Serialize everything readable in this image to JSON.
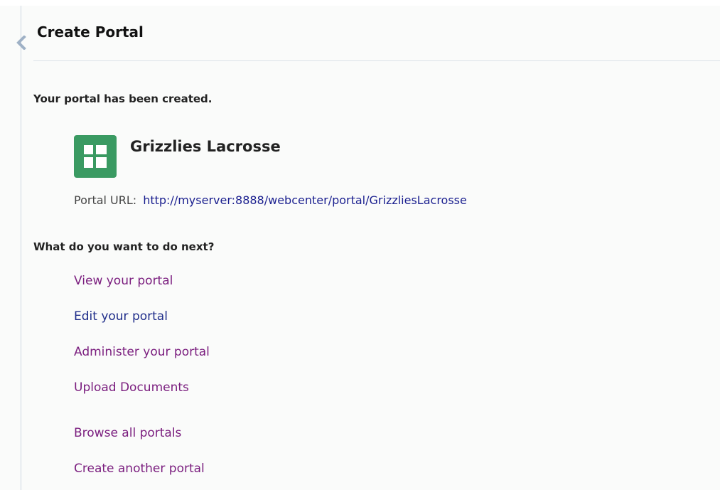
{
  "header": {
    "title": "Create Portal",
    "back_icon": "chevron-left-icon"
  },
  "main": {
    "created_message": "Your portal has been created.",
    "portal": {
      "name": "Grizzlies Lacrosse",
      "icon": "portal-tiles-icon",
      "icon_color": "#3a9a62",
      "url_label": "Portal URL:",
      "url": "http://myserver:8888/webcenter/portal/GrizzliesLacrosse"
    },
    "next_heading": "What do you want to do next?",
    "actions": [
      {
        "label": "View your portal",
        "visited": true
      },
      {
        "label": "Edit your portal",
        "visited": false
      },
      {
        "label": "Administer your portal",
        "visited": true
      },
      {
        "label": "Upload Documents",
        "visited": true
      },
      {
        "label": "Browse all portals",
        "visited": true
      },
      {
        "label": "Create another portal",
        "visited": true
      }
    ]
  },
  "colors": {
    "visited_link": "#7a1d7e",
    "link": "#1f2d8a",
    "url_link": "#1a1f8f"
  }
}
